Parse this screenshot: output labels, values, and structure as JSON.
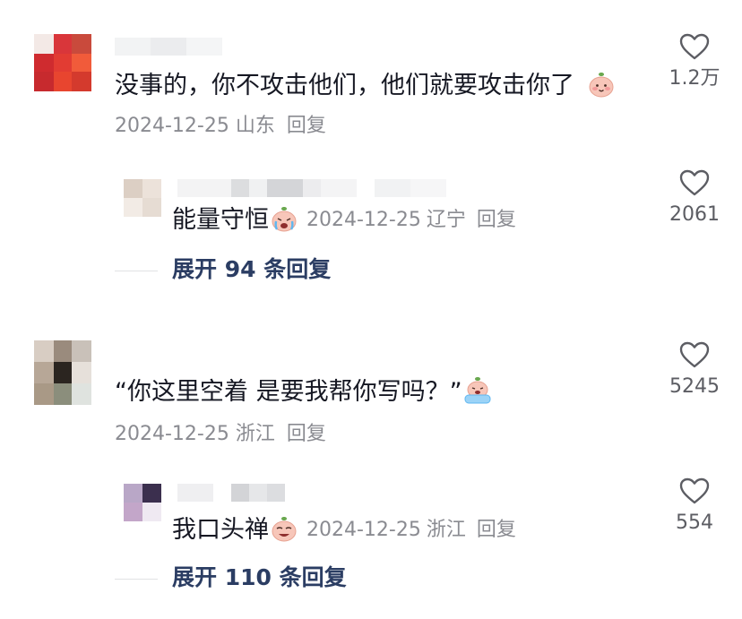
{
  "comments": [
    {
      "text": "没事的，你不攻击他们，他们就要攻击你了",
      "emoji": "smiling-peach-emoji",
      "date": "2024-12-25",
      "location": "山东",
      "reply_label": "回复",
      "likes": "1.2万",
      "replies": [
        {
          "text": "能量守恒",
          "emoji": "crying-peach-emoji",
          "date": "2024-12-25",
          "location": "辽宁",
          "reply_label": "回复",
          "likes": "2061"
        }
      ],
      "expand_label": "展开 94 条回复"
    },
    {
      "text": "“你这里空着 是要我帮你写吗？”",
      "emoji": "tearful-peach-emoji",
      "date": "2024-12-25",
      "location": "浙江",
      "reply_label": "回复",
      "likes": "5245",
      "replies": [
        {
          "text": "我口头禅",
          "emoji": "weeping-peach-emoji",
          "date": "2024-12-25",
          "location": "浙江",
          "reply_label": "回复",
          "likes": "554"
        }
      ],
      "expand_label": "展开 110 条回复"
    }
  ],
  "icons": {
    "like": "heart-outline-icon"
  },
  "colors": {
    "text": "#161823",
    "meta": "#8a8b91",
    "expand": "#2b3d63",
    "heart": "#5c5d63"
  }
}
